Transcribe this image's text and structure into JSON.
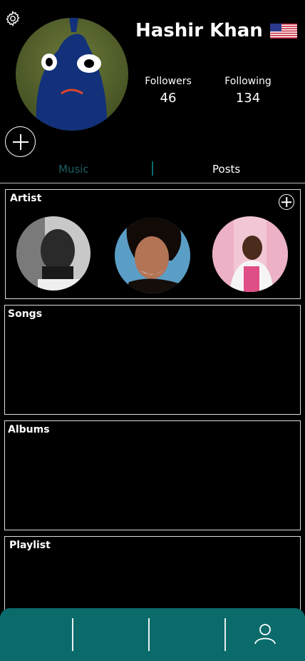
{
  "profile": {
    "name": "Hashir Khan",
    "followers_label": "Followers",
    "followers_count": "46",
    "following_label": "Following",
    "following_count": "134",
    "country_flag_icon": "us-flag-icon"
  },
  "tabs": [
    {
      "label": "Music",
      "active": true
    },
    {
      "label": "Posts",
      "active": false
    }
  ],
  "sections": {
    "artist": {
      "title": "Artist"
    },
    "songs": {
      "title": "Songs"
    },
    "albums": {
      "title": "Albums"
    },
    "playlist": {
      "title": "Playlist"
    }
  },
  "colors": {
    "accent": "#0b6b6b",
    "background": "#000000",
    "text": "#ffffff"
  },
  "bottom_nav": {
    "items": [
      "",
      "",
      "",
      "user-icon"
    ]
  }
}
